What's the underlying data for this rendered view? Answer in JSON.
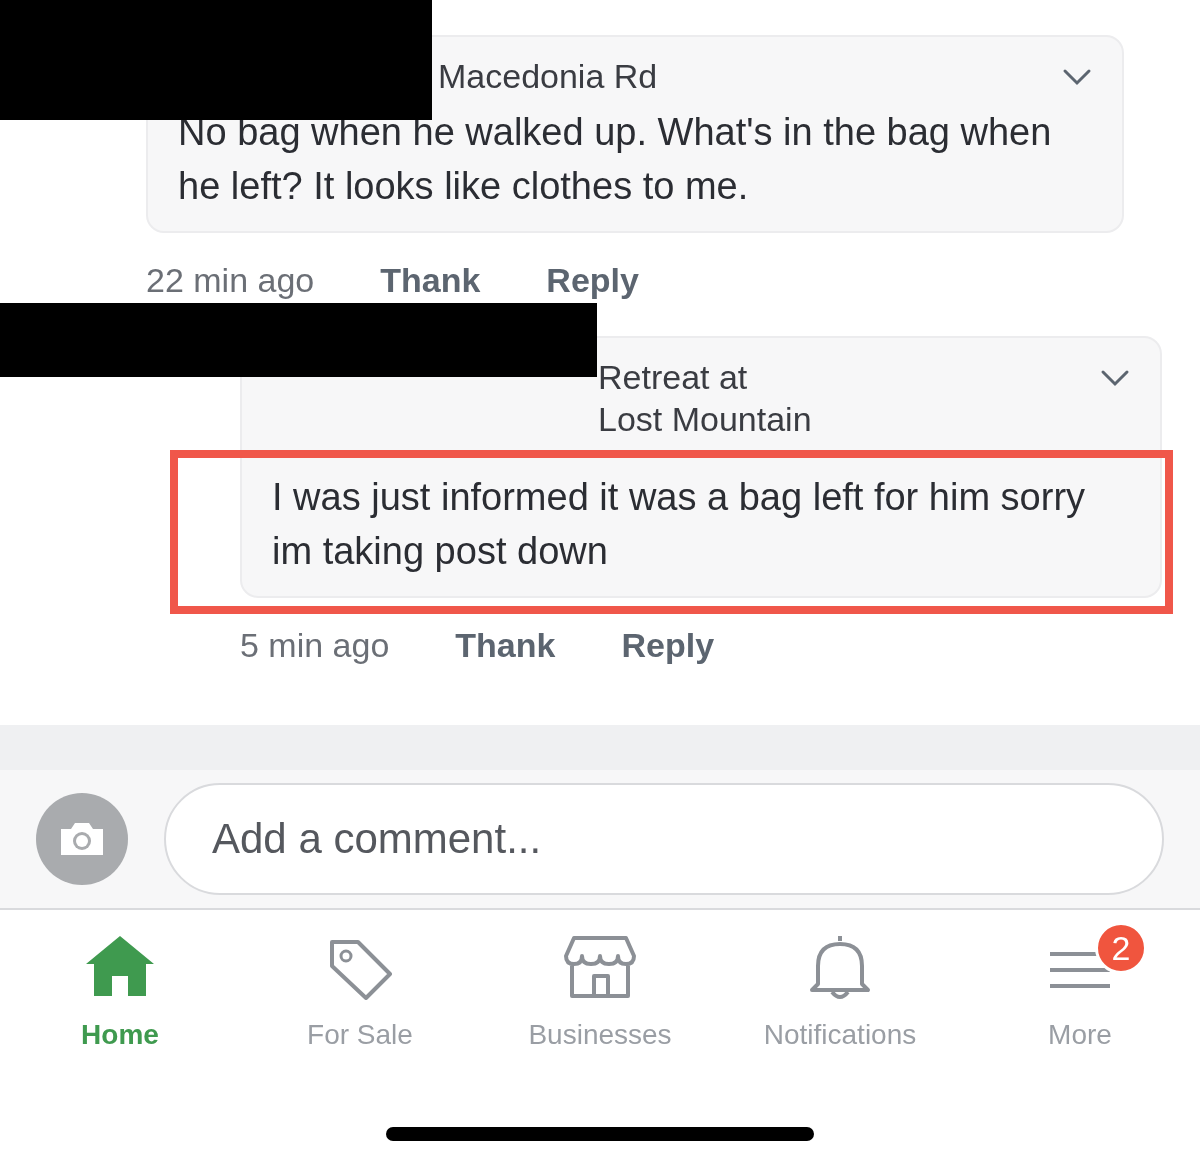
{
  "comments": [
    {
      "author_redacted": true,
      "header_lines": [
        "Macedonia Rd"
      ],
      "text": "No bag when he walked up. What's in the bag when he left? It looks like clothes to me.",
      "highlighted": false,
      "time": "22 min ago",
      "actions": [
        "Thank",
        "Reply"
      ],
      "indent": false
    },
    {
      "author_redacted": true,
      "header_lines": [
        "Retreat at",
        "Lost Mountain"
      ],
      "text": "I was just informed it was a bag left for him sorry im taking post down",
      "highlighted": true,
      "time": "5 min ago",
      "actions": [
        "Thank",
        "Reply"
      ],
      "indent": true
    }
  ],
  "composer": {
    "placeholder": "Add a comment..."
  },
  "tabs": [
    {
      "label": "Home",
      "selected": true
    },
    {
      "label": "For Sale",
      "selected": false
    },
    {
      "label": "Businesses",
      "selected": false
    },
    {
      "label": "Notifications",
      "selected": false
    },
    {
      "label": "More",
      "selected": false,
      "badge": "2"
    }
  ]
}
